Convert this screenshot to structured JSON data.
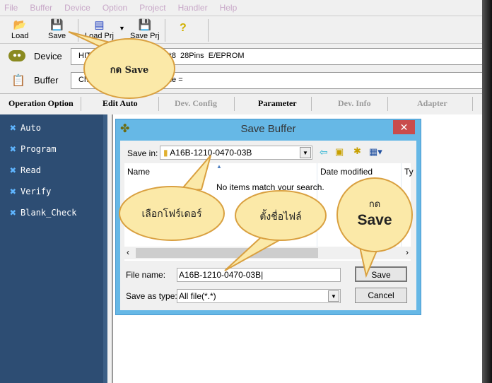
{
  "menu": [
    "File",
    "Buffer",
    "Device",
    "Option",
    "Project",
    "Handler",
    "Help"
  ],
  "toolbar": {
    "load": "Load",
    "save": "Save",
    "load_prj": "Load Prj",
    "save_prj": "Save Prj"
  },
  "device": {
    "label": "Device",
    "value": "HIT                                    *8  28Pins  E/EPROM"
  },
  "buffer": {
    "label": "Buffer",
    "value": "Ch                                     ile ="
  },
  "tabs": [
    "Operation Option",
    "Edit Auto",
    "Dev. Config",
    "Parameter",
    "Dev. Info",
    "Adapter",
    "D"
  ],
  "sidebar": [
    "Auto",
    "Program",
    "Read",
    "Verify",
    "Blank_Check"
  ],
  "dialog": {
    "title": "Save Buffer",
    "save_in_label": "Save in:",
    "save_in_value": "A16B-1210-0470-03B",
    "col_name": "Name",
    "col_date": "Date modified",
    "col_type": "Ty",
    "empty": "No items match your search.",
    "file_name_label": "File name:",
    "file_name_value": "A16B-1210-0470-03B",
    "type_label": "Save as type:",
    "type_value": "All file(*.*)",
    "save": "Save",
    "cancel": "Cancel"
  },
  "callouts": {
    "press_save": "กด Save",
    "select_folder": "เลือกโฟร์เดอร์",
    "name_file": "ตั้งชื่อไฟล์",
    "press2": "กด",
    "save2": "Save"
  },
  "colors": {
    "sidebar": "#2d4d73",
    "title_bar": "#66b8e6",
    "callout": "#fbe9a8",
    "callout_border": "#d9a040"
  }
}
